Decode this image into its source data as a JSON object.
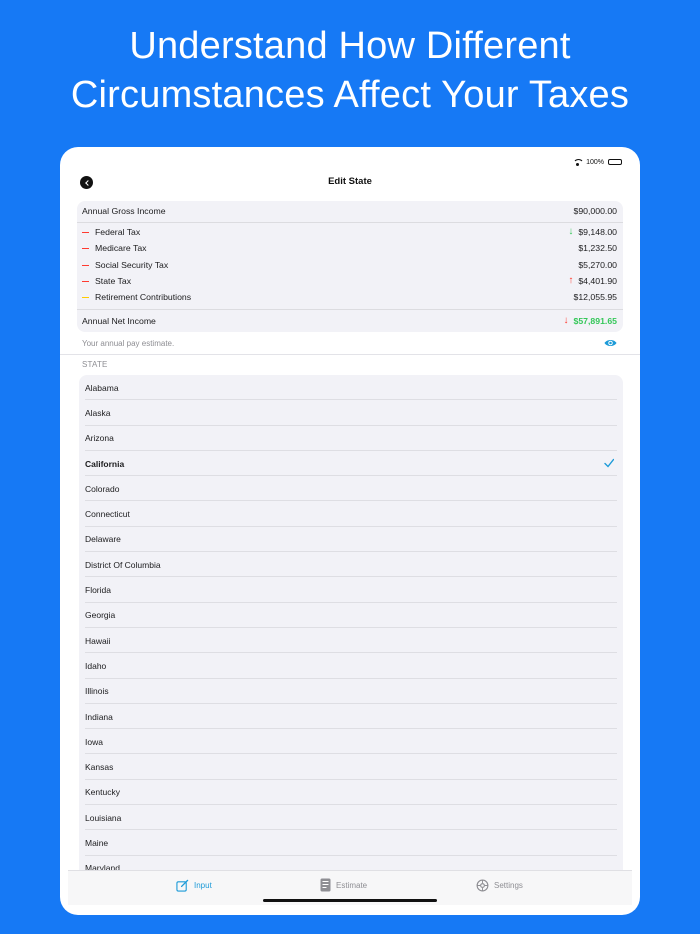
{
  "headline": {
    "line1": "Understand How Different",
    "line2": "Circumstances Affect Your Taxes"
  },
  "status_bar": {
    "battery": "100%"
  },
  "nav": {
    "title": "Edit State",
    "back_icon": "chevron-left-circle-icon"
  },
  "summary": {
    "gross": {
      "label": "Annual Gross Income",
      "value": "$90,000.00"
    },
    "items": [
      {
        "label": "Federal Tax",
        "value": "$9,148.00",
        "dash_color": "#ff3b30",
        "trend": "down",
        "trend_color": "#34c759"
      },
      {
        "label": "Medicare Tax",
        "value": "$1,232.50",
        "dash_color": "#ff3b30",
        "trend": "",
        "trend_color": ""
      },
      {
        "label": "Social Security Tax",
        "value": "$5,270.00",
        "dash_color": "#ff3b30",
        "trend": "",
        "trend_color": ""
      },
      {
        "label": "State Tax",
        "value": "$4,401.90",
        "dash_color": "#ff3b30",
        "trend": "up",
        "trend_color": "#ff3b30"
      },
      {
        "label": "Retirement Contributions",
        "value": "$12,055.95",
        "dash_color": "#ffcc00",
        "trend": "",
        "trend_color": ""
      }
    ],
    "net": {
      "label": "Annual Net Income",
      "value": "$57,891.65",
      "trend": "down",
      "value_color": "#34c759"
    }
  },
  "footer_note": "Your annual pay estimate.",
  "section_header": "STATE",
  "states": [
    "Alabama",
    "Alaska",
    "Arizona",
    "California",
    "Colorado",
    "Connecticut",
    "Delaware",
    "District Of Columbia",
    "Florida",
    "Georgia",
    "Hawaii",
    "Idaho",
    "Illinois",
    "Indiana",
    "Iowa",
    "Kansas",
    "Kentucky",
    "Louisiana",
    "Maine",
    "Maryland"
  ],
  "selected_state": "California",
  "tabs": [
    {
      "label": "Input",
      "icon": "edit-icon",
      "active": true
    },
    {
      "label": "Estimate",
      "icon": "document-icon",
      "active": false
    },
    {
      "label": "Settings",
      "icon": "gear-icon",
      "active": false
    }
  ],
  "colors": {
    "background": "#1679f5",
    "accent": "#1d9bd8",
    "positive": "#34c759",
    "negative": "#ff3b30"
  }
}
